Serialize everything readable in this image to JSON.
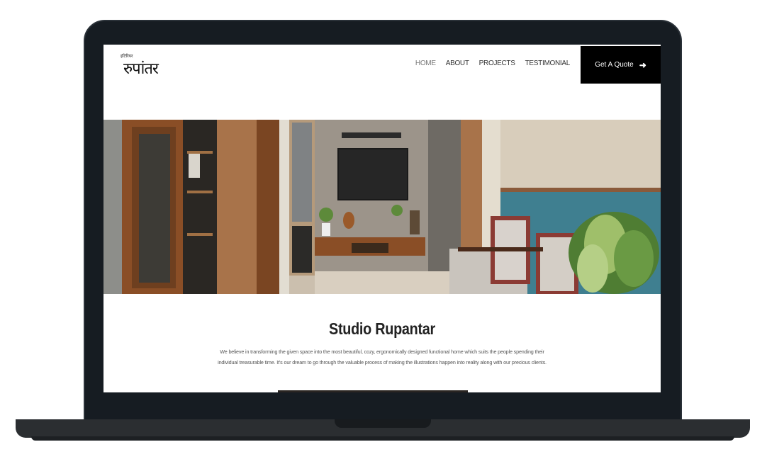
{
  "brand": {
    "logo_small": "इंटिरियर",
    "logo_main": "रुपांतर"
  },
  "nav": {
    "links": [
      "HOME",
      "ABOUT",
      "PROJECTS",
      "TESTIMONIAL"
    ],
    "active": "HOME",
    "cta_label": "Get A Quote",
    "cta_icon": "arrow-right-icon"
  },
  "intro": {
    "title": "Studio Rupantar",
    "text": "We believe in transforming the given space into the most beautiful, cozy, ergonomically designed functional home which suits the people spending their individual treasurable time. It's our dream to go through the valuable process of making the illustrations happen into reality along with our precious clients."
  },
  "colors": {
    "cta_bg": "#000000",
    "device_frame": "#161c22",
    "teal_wall": "#3f7f90"
  }
}
